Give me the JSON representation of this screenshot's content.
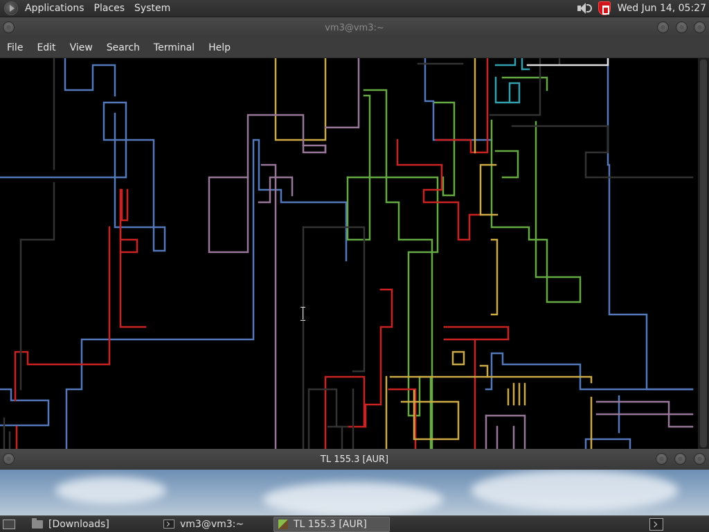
{
  "top_panel": {
    "menus": [
      "Applications",
      "Places",
      "System"
    ],
    "clock": "Wed Jun 14, 05:27",
    "icons": {
      "logo": "distro-logo-icon",
      "volume": "speaker-icon",
      "security": "shield-icon"
    },
    "colors": {
      "shield": "#d0141b"
    }
  },
  "terminal_window": {
    "title": "vm3@vm3:~",
    "menus": [
      "File",
      "Edit",
      "View",
      "Search",
      "Terminal",
      "Help"
    ]
  },
  "pipes_colors": {
    "blue": "#5577bb",
    "green": "#66aa44",
    "red": "#cc2222",
    "yellow": "#ccaa44",
    "purple": "#997799",
    "gray": "#333333",
    "cyan": "#33a0b0",
    "white": "#e0e0e0"
  },
  "tl_window": {
    "title": "TL 155.3 [AUR]"
  },
  "taskbar": {
    "tasks": [
      {
        "label": "[Downloads]",
        "icon": "folder-icon",
        "active": false
      },
      {
        "label": "vm3@vm3:~",
        "icon": "terminal-icon",
        "active": false
      },
      {
        "label": "TL 155.3 [AUR]",
        "icon": "cube-icon",
        "active": true
      }
    ]
  }
}
